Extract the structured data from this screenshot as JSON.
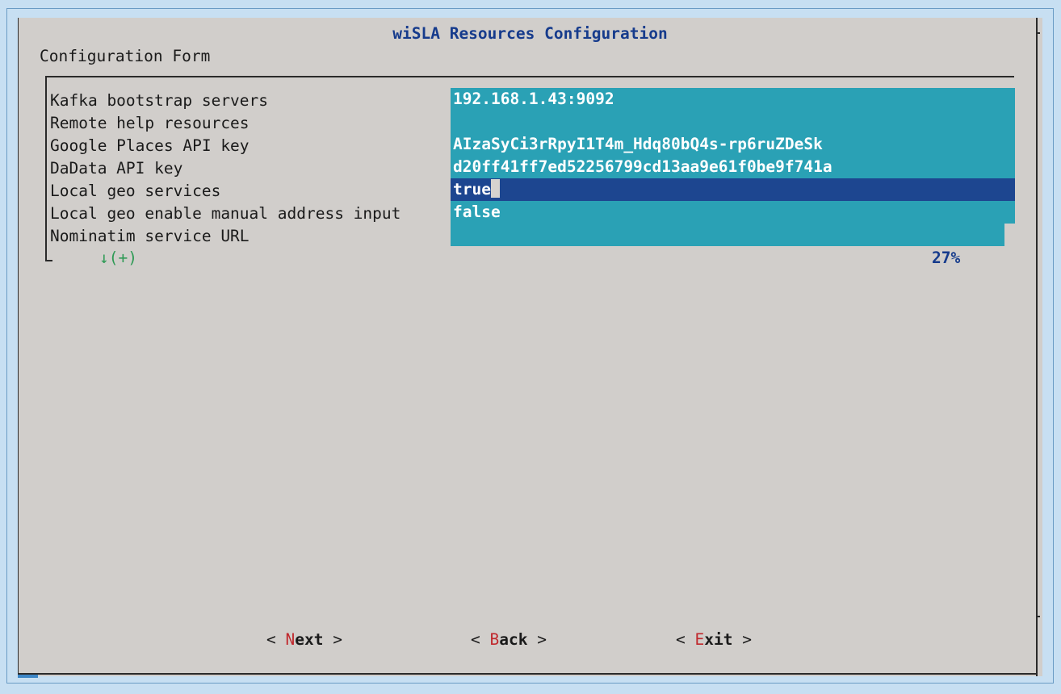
{
  "dialog": {
    "title": "wiSLA Resources Configuration",
    "subtitle": "Configuration Form"
  },
  "form": {
    "rows": [
      {
        "label": "Kafka bootstrap servers",
        "value": "192.168.1.43:9092"
      },
      {
        "label": "Remote help resources",
        "value": ""
      },
      {
        "label": "Google Places API key",
        "value": "AIzaSyCi3rRpyI1T4m_Hdq80bQ4s-rp6ruZDeSk"
      },
      {
        "label": "DaData API key",
        "value": "d20ff41ff7ed52256799cd13aa9e61f0be9f741a"
      },
      {
        "label": "Local geo services",
        "value": "true"
      },
      {
        "label": "Local geo enable manual address input",
        "value": "false"
      },
      {
        "label": "Nominatim service URL",
        "value": ""
      }
    ],
    "more_indicator": "↓(+)",
    "scroll_percent": "27%"
  },
  "buttons": {
    "next": {
      "open": "< ",
      "hotkey": "N",
      "rest": "ext",
      "close": " >"
    },
    "back": {
      "open": "< ",
      "hotkey": "B",
      "rest": "ack",
      "close": " >"
    },
    "exit": {
      "open": "< ",
      "hotkey": "E",
      "rest": "xit",
      "close": " >"
    }
  },
  "colors": {
    "background": "#c7dff2",
    "dialog": "#d1cecb",
    "field": "#2aa1b5",
    "field_focused": "#1d4690",
    "title": "#163b8c",
    "hotkey": "#c0282d",
    "indicator": "#2e9a55"
  }
}
